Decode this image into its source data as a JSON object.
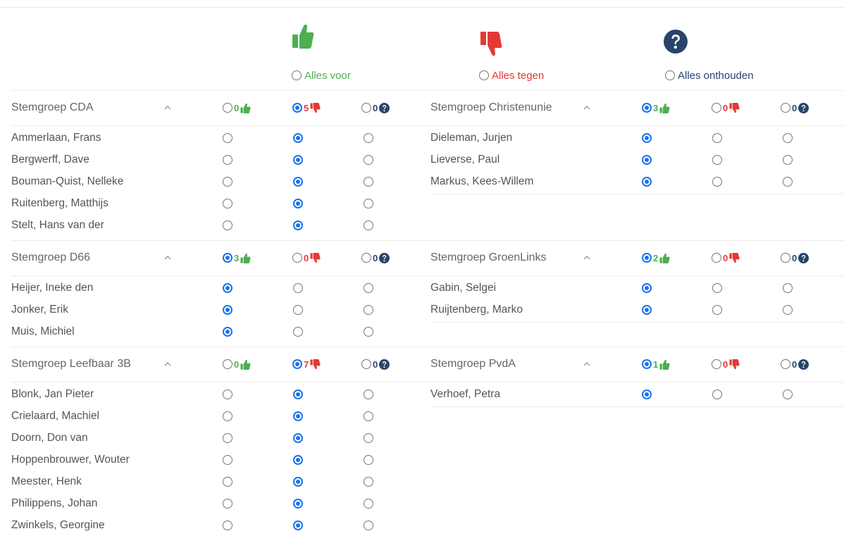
{
  "header": {
    "all_for": "Alles voor",
    "all_against": "Alles tegen",
    "all_abstain": "Alles onthouden"
  },
  "colors": {
    "for": "#4caf50",
    "against": "#e53935",
    "abstain": "#27456b",
    "radio": "#1a73e8"
  },
  "groups": [
    {
      "name": "Stemgroep CDA",
      "counts": {
        "for": "0",
        "against": "5",
        "abstain": "0"
      },
      "selected": "against",
      "members": [
        {
          "name": "Ammerlaan, Frans",
          "vote": "against"
        },
        {
          "name": "Bergwerff, Dave",
          "vote": "against"
        },
        {
          "name": "Bouman-Quist, Nelleke",
          "vote": "against"
        },
        {
          "name": "Ruitenberg, Matthijs",
          "vote": "against"
        },
        {
          "name": "Stelt, Hans van der",
          "vote": "against"
        }
      ]
    },
    {
      "name": "Stemgroep Christenunie",
      "counts": {
        "for": "3",
        "against": "0",
        "abstain": "0"
      },
      "selected": "for",
      "members": [
        {
          "name": "Dieleman, Jurjen",
          "vote": "for"
        },
        {
          "name": "Lieverse, Paul",
          "vote": "for"
        },
        {
          "name": "Markus, Kees-Willem",
          "vote": "for"
        }
      ]
    },
    {
      "name": "Stemgroep D66",
      "counts": {
        "for": "3",
        "against": "0",
        "abstain": "0"
      },
      "selected": "for",
      "members": [
        {
          "name": "Heijer, Ineke den",
          "vote": "for"
        },
        {
          "name": "Jonker, Erik",
          "vote": "for"
        },
        {
          "name": "Muis, Michiel",
          "vote": "for"
        }
      ]
    },
    {
      "name": "Stemgroep GroenLinks",
      "counts": {
        "for": "2",
        "against": "0",
        "abstain": "0"
      },
      "selected": "for",
      "members": [
        {
          "name": "Gabin, Selgei",
          "vote": "for"
        },
        {
          "name": "Ruijtenberg, Marko",
          "vote": "for"
        }
      ]
    },
    {
      "name": "Stemgroep Leefbaar 3B",
      "counts": {
        "for": "0",
        "against": "7",
        "abstain": "0"
      },
      "selected": "against",
      "members": [
        {
          "name": "Blonk, Jan Pieter",
          "vote": "against"
        },
        {
          "name": "Crielaard, Machiel",
          "vote": "against"
        },
        {
          "name": "Doorn, Don van",
          "vote": "against"
        },
        {
          "name": "Hoppenbrouwer, Wouter",
          "vote": "against"
        },
        {
          "name": "Meester, Henk",
          "vote": "against"
        },
        {
          "name": "Philippens, Johan",
          "vote": "against"
        },
        {
          "name": "Zwinkels, Georgine",
          "vote": "against"
        }
      ]
    },
    {
      "name": "Stemgroep PvdA",
      "counts": {
        "for": "1",
        "against": "0",
        "abstain": "0"
      },
      "selected": "for",
      "members": [
        {
          "name": "Verhoef, Petra",
          "vote": "for"
        }
      ]
    }
  ]
}
